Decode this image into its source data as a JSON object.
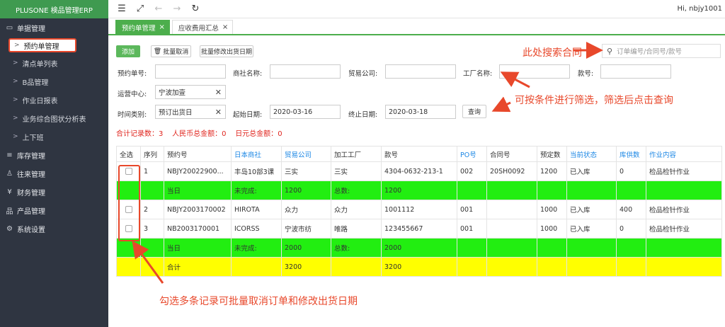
{
  "app": {
    "brand": "PLUSONE 検品管理ERP",
    "user": "Hi, nbjy1001"
  },
  "sidebar": {
    "groups": [
      {
        "label": "单据管理",
        "icon": "monitor-icon"
      },
      {
        "label": "库存管理",
        "icon": "database-icon"
      },
      {
        "label": "往来管理",
        "icon": "user-icon"
      },
      {
        "label": "财务管理",
        "icon": "money-icon"
      },
      {
        "label": "产品管理",
        "icon": "sitemap-icon"
      },
      {
        "label": "系统设置",
        "icon": "gear-icon"
      }
    ],
    "sub_items": [
      "预约单管理",
      "清点单列表",
      "B品管理",
      "作业日报表",
      "业务综合图状分析表",
      "上下班"
    ]
  },
  "tabs": [
    {
      "label": "预约单管理"
    },
    {
      "label": "应收费用汇总"
    }
  ],
  "toolbar": {
    "add": "添加",
    "batch_cancel": "批量取消",
    "batch_modify": "批量修改出货日期",
    "search_placeholder": "订单编号/合同号/款号"
  },
  "filters": {
    "order_no": "预约单号:",
    "company": "商社名称:",
    "trade_company": "贸易公司:",
    "factory": "工厂名称:",
    "style_no": "款号:",
    "ops_center": "运营中心:",
    "ops_center_value": "宁波加壹",
    "time_type": "时间类别:",
    "time_type_value": "预订出货日",
    "start_date": "起始日期:",
    "start_date_value": "2020-03-16",
    "end_date": "终止日期:",
    "end_date_value": "2020-03-18",
    "query_btn": "查询"
  },
  "summary": {
    "total_label": "合计记录数：",
    "total_value": "3",
    "rmb_label": "人民币总金额：",
    "rmb_value": "0",
    "jpy_label": "日元总金额：",
    "jpy_value": "0"
  },
  "annotations": {
    "search": "此处搜索合同",
    "filter": "可按条件进行筛选，筛选后点击查询",
    "batch": "勾选多条记录可批量取消订单和修改出货日期"
  },
  "table": {
    "headers": [
      "全选",
      "序列",
      "预约号",
      "日本商社",
      "贸易公司",
      "加工工厂",
      "款号",
      "PO号",
      "合同号",
      "预定数",
      "当前状态",
      "库供数",
      "作业内容"
    ],
    "rows": [
      {
        "type": "data",
        "cells": [
          "",
          "1",
          "NBJY20022900...",
          "丰岛10部3课",
          "三实",
          "三实",
          "4304-0632-213-1",
          "002",
          "20SH0092",
          "1200",
          "已入库",
          "0",
          "检品检针作业"
        ]
      },
      {
        "type": "green",
        "cells": [
          "",
          "",
          "当日",
          "未完成:",
          "1200",
          "总数:",
          "1200",
          "",
          "",
          "",
          "",
          "",
          ""
        ]
      },
      {
        "type": "data",
        "cells": [
          "",
          "2",
          "NBJY2003170002",
          "HIROTA",
          "众力",
          "众力",
          "1001112",
          "001",
          "",
          "1000",
          "已入库",
          "400",
          "检品检针作业"
        ]
      },
      {
        "type": "data",
        "cells": [
          "",
          "3",
          "NB2003170001",
          "ICORSS",
          "宁波市纺",
          "唯路",
          "123455667",
          "001",
          "",
          "1000",
          "已入库",
          "0",
          "检品检针作业"
        ]
      },
      {
        "type": "green",
        "cells": [
          "",
          "",
          "当日",
          "未完成:",
          "2000",
          "总数:",
          "2000",
          "",
          "",
          "",
          "",
          "",
          ""
        ]
      },
      {
        "type": "yellow",
        "cells": [
          "",
          "",
          "合计",
          "",
          "3200",
          "",
          "3200",
          "",
          "",
          "",
          "",
          "",
          ""
        ]
      }
    ]
  }
}
